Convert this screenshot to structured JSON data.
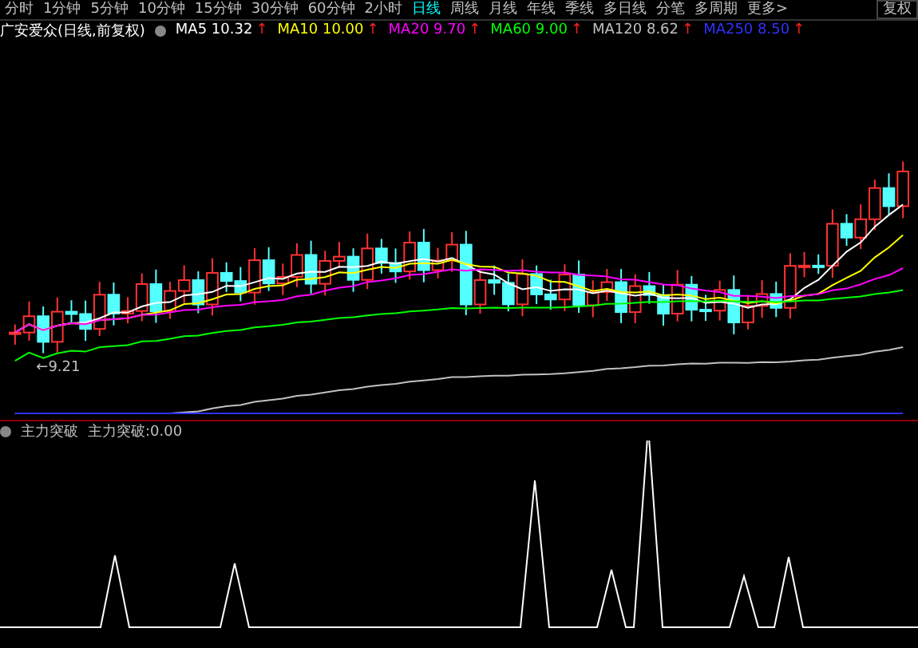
{
  "toolbar": {
    "items": [
      {
        "label": "分时",
        "selected": false
      },
      {
        "label": "1分钟",
        "selected": false
      },
      {
        "label": "5分钟",
        "selected": false
      },
      {
        "label": "10分钟",
        "selected": false
      },
      {
        "label": "15分钟",
        "selected": false
      },
      {
        "label": "30分钟",
        "selected": false
      },
      {
        "label": "60分钟",
        "selected": false
      },
      {
        "label": "2小时",
        "selected": false
      },
      {
        "label": "日线",
        "selected": true
      },
      {
        "label": "周线",
        "selected": false
      },
      {
        "label": "月线",
        "selected": false
      },
      {
        "label": "年线",
        "selected": false
      },
      {
        "label": "季线",
        "selected": false
      },
      {
        "label": "多日线",
        "selected": false
      },
      {
        "label": "分笔",
        "selected": false
      },
      {
        "label": "多周期",
        "selected": false
      },
      {
        "label": "更多>",
        "selected": false
      }
    ],
    "right_button": "复权"
  },
  "main_chart": {
    "title": "广安爱众(日线,前复权)",
    "averages": [
      {
        "name": "MA5",
        "value": "10.32",
        "arrow": "↑",
        "color": "#ffffff"
      },
      {
        "name": "MA10",
        "value": "10.00",
        "arrow": "↑",
        "color": "#ffff00"
      },
      {
        "name": "MA20",
        "value": "9.70",
        "arrow": "↑",
        "color": "#ff00ff"
      },
      {
        "name": "MA60",
        "value": "9.00",
        "arrow": "↑",
        "color": "#00ff00"
      },
      {
        "name": "MA120",
        "value": "8.62",
        "arrow": "↑",
        "color": "#c0c0c0"
      },
      {
        "name": "MA250",
        "value": "8.50",
        "arrow": "↑",
        "color": "#3030ff"
      }
    ],
    "low_label": "←9.21"
  },
  "indicator": {
    "name": "主力突破",
    "reading_label": "主力突破:",
    "reading": "0.00"
  }
}
